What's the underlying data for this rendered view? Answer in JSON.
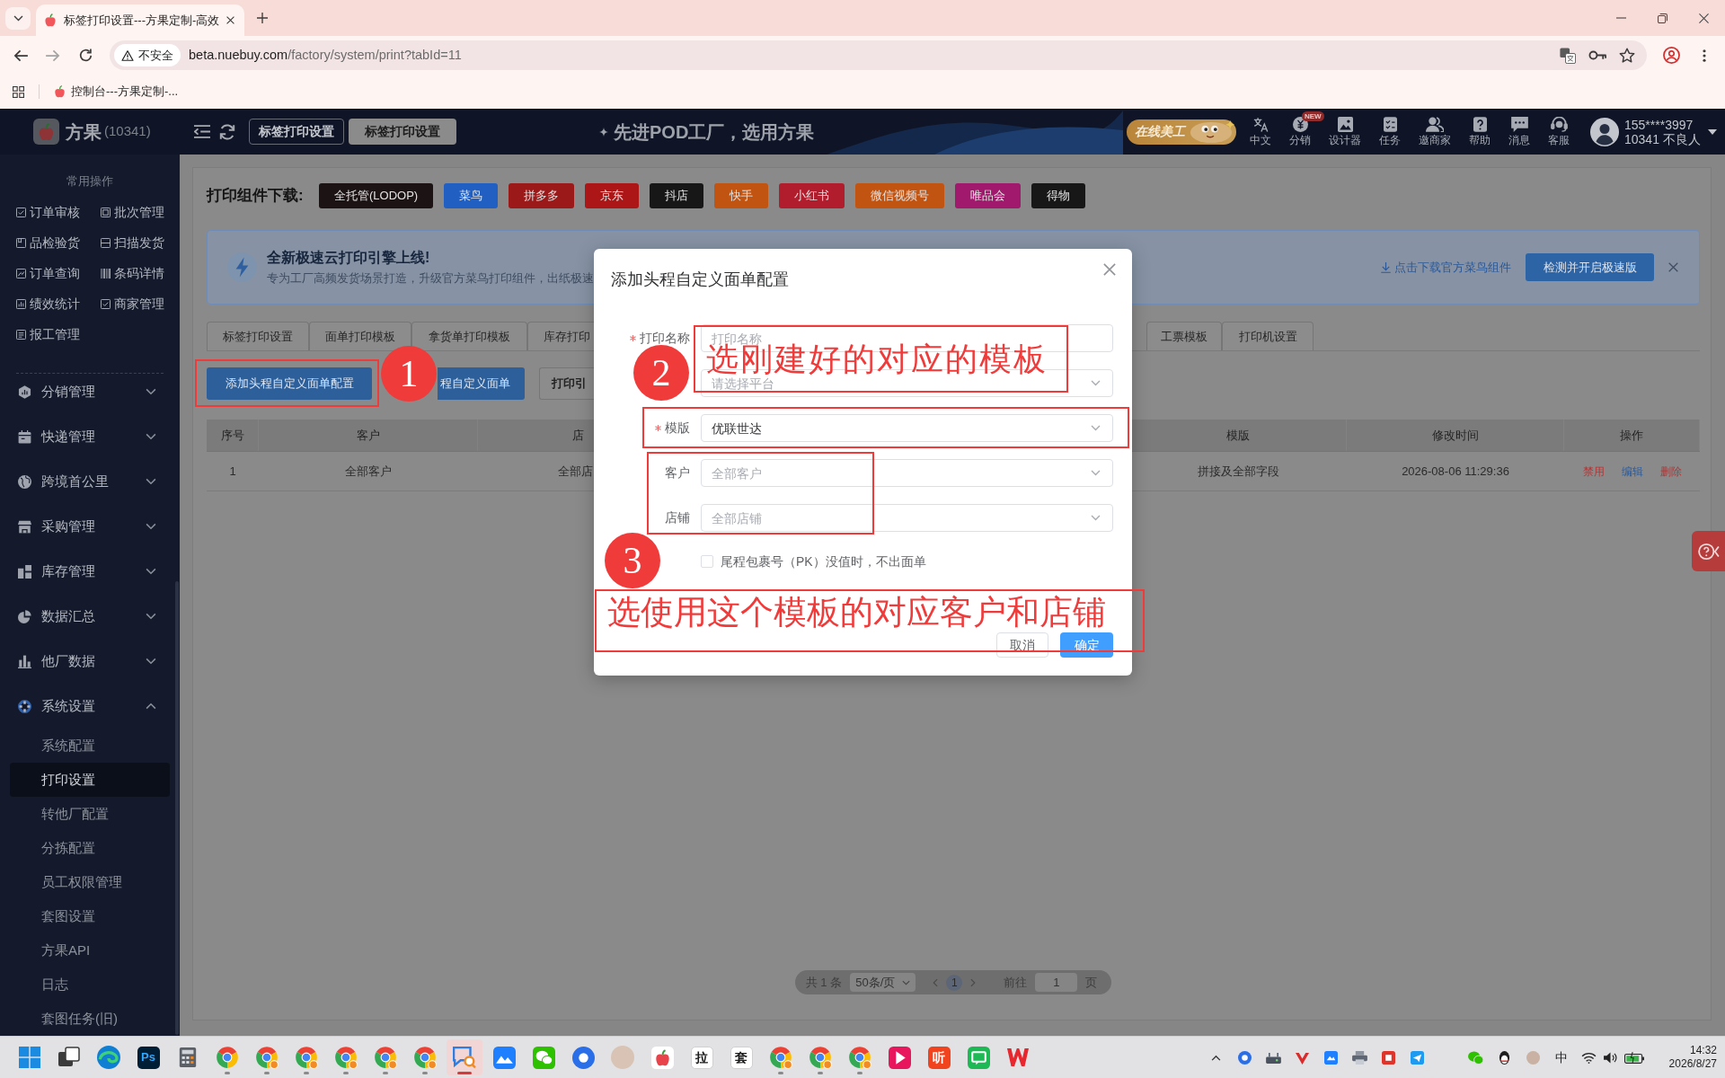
{
  "browser": {
    "tab_title": "标签打印设置---方果定制-高效",
    "security": "不安全",
    "url_host": "beta.nuebuy.com",
    "url_path": "/factory/system/print?tabId=11",
    "bookmarks": [
      {
        "label": "控制台---方果定制-..."
      }
    ]
  },
  "header": {
    "brand": "方果",
    "brand_id": "(10341)",
    "breadcrumbs": [
      {
        "label": "标签打印设置",
        "selected": false
      },
      {
        "label": "标签打印设置",
        "selected": true
      }
    ],
    "slogan": "先进POD工厂，选用方果",
    "promo": "在线美工",
    "tools": [
      {
        "kind": "translate",
        "label": "中文"
      },
      {
        "kind": "coin",
        "label": "分销",
        "badge": "NEW"
      },
      {
        "kind": "image",
        "label": "设计器"
      },
      {
        "kind": "task",
        "label": "任务"
      },
      {
        "kind": "people",
        "label": "邀商家"
      },
      {
        "kind": "help",
        "label": "帮助"
      },
      {
        "kind": "message",
        "label": "消息"
      },
      {
        "kind": "support",
        "label": "客服"
      }
    ],
    "user": {
      "phone": "155****3997",
      "account": "10341 不良人"
    }
  },
  "sidebar": {
    "quick_title": "常用操作",
    "quick": [
      {
        "kind": "check",
        "label": "订单审核"
      },
      {
        "kind": "batch",
        "label": "批次管理"
      },
      {
        "kind": "inspect",
        "label": "品检验货"
      },
      {
        "kind": "scan",
        "label": "扫描发货"
      },
      {
        "kind": "search",
        "label": "订单查询"
      },
      {
        "kind": "barcode",
        "label": "条码详情"
      },
      {
        "kind": "stats",
        "label": "绩效统计"
      },
      {
        "kind": "check",
        "label": "商家管理"
      },
      {
        "kind": "report",
        "label": "报工管理"
      }
    ],
    "menu": [
      {
        "kind": "distribution",
        "label": "分销管理",
        "expanded": false
      },
      {
        "kind": "express",
        "label": "快递管理",
        "expanded": false
      },
      {
        "kind": "globe",
        "label": "跨境首公里",
        "expanded": false
      },
      {
        "kind": "store",
        "label": "采购管理",
        "expanded": false
      },
      {
        "kind": "stock",
        "label": "库存管理",
        "expanded": false
      },
      {
        "kind": "pie",
        "label": "数据汇总",
        "expanded": false
      },
      {
        "kind": "bars",
        "label": "他厂数据",
        "expanded": false
      },
      {
        "kind": "settings",
        "label": "系统设置",
        "expanded": true,
        "children": [
          {
            "label": "系统配置",
            "selected": false
          },
          {
            "label": "打印设置",
            "selected": true
          },
          {
            "label": "转他厂配置",
            "selected": false
          },
          {
            "label": "分拣配置",
            "selected": false
          },
          {
            "label": "员工权限管理",
            "selected": false
          },
          {
            "label": "套图设置",
            "selected": false
          },
          {
            "label": "方果API",
            "selected": false
          },
          {
            "label": "日志",
            "selected": false
          },
          {
            "label": "套图任务(旧)",
            "selected": false
          }
        ]
      }
    ]
  },
  "main": {
    "download": {
      "label": "打印组件下载:",
      "items": [
        {
          "label": "全托管(LODOP)",
          "color": "#1c1315"
        },
        {
          "label": "菜鸟",
          "color": "#2160c2"
        },
        {
          "label": "拼多多",
          "color": "#9c1919"
        },
        {
          "label": "京东",
          "color": "#ad1616"
        },
        {
          "label": "抖店",
          "color": "#171717"
        },
        {
          "label": "快手",
          "color": "#c25412"
        },
        {
          "label": "小红书",
          "color": "#b21d2d"
        },
        {
          "label": "微信视频号",
          "color": "#c25412"
        },
        {
          "label": "唯品会",
          "color": "#a0196c"
        },
        {
          "label": "得物",
          "color": "#171717"
        }
      ]
    },
    "notice": {
      "title": "全新极速云打印引擎上线!",
      "text": "专为工厂高频发货场景打造，升级官方菜鸟打印组件，出纸极速",
      "link": "点击下载官方菜鸟组件",
      "button": "检测并开启极速版"
    },
    "tabs": [
      {
        "label": "标签打印设置"
      },
      {
        "label": "面单打印模板"
      },
      {
        "label": "拿货单打印模板"
      },
      {
        "label": "库存打印"
      },
      {
        "label": "工票模板"
      },
      {
        "label": "打印机设置"
      }
    ],
    "actions": [
      {
        "kind": "button",
        "label": "添加头程自定义面单配置"
      },
      {
        "kind": "button",
        "label": "程自定义面单"
      },
      {
        "kind": "select",
        "label": "打印引"
      }
    ],
    "table": {
      "columns": [
        "序号",
        "客户",
        "店",
        "模版",
        "修改时间",
        "操作"
      ],
      "rows": [
        {
          "cells": [
            "1",
            "全部客户",
            "全部店",
            "拼接及全部字段",
            "2026-08-06 11:29:36"
          ],
          "actions": [
            {
              "label": "禁用",
              "kind": "danger"
            },
            {
              "label": "编辑",
              "kind": "primary"
            },
            {
              "label": "删除",
              "kind": "danger"
            }
          ]
        }
      ]
    },
    "pagination": {
      "total": "共 1 条",
      "page_size": "50条/页",
      "pages": [
        {
          "label": "1",
          "selected": true
        }
      ],
      "goto_label": "前往",
      "goto_value": "1",
      "goto_unit": "页"
    }
  },
  "dialog": {
    "title": "添加头程自定义面单配置",
    "fields": [
      {
        "kind": "input",
        "label": "打印名称",
        "required": true,
        "placeholder": "打印名称"
      },
      {
        "kind": "select",
        "required": false,
        "placeholder": "请选择平台"
      },
      {
        "kind": "select",
        "label": "模版",
        "required": true,
        "value": "优联世达"
      },
      {
        "kind": "select",
        "label": "客户",
        "required": false,
        "placeholder": "全部客户"
      },
      {
        "kind": "select",
        "label": "店铺",
        "required": false,
        "placeholder": "全部店铺"
      }
    ],
    "checkbox": {
      "label": "尾程包裹号（PK）没值时，不出面单",
      "checked": false
    },
    "buttons": [
      {
        "kind": "secondary",
        "label": "取消"
      },
      {
        "kind": "primary",
        "label": "确定"
      }
    ]
  },
  "annotations": [
    {
      "number": "1"
    },
    {
      "number": "2",
      "note": "选刚建好的对应的模板"
    },
    {
      "number": "3",
      "note": "选使用这个模板的对应客户和店铺"
    }
  ],
  "taskbar": {
    "apps": [
      {
        "kind": "windows",
        "running": false,
        "active": false
      },
      {
        "kind": "taskview",
        "running": false,
        "active": false
      },
      {
        "kind": "edge",
        "running": false,
        "active": false
      },
      {
        "kind": "photoshop",
        "label": "Ps",
        "running": false,
        "active": false
      },
      {
        "kind": "calculator",
        "running": false,
        "active": false
      },
      {
        "kind": "chrome",
        "running": true,
        "active": false
      },
      {
        "kind": "chrome_profile",
        "running": true,
        "active": false
      },
      {
        "kind": "chrome_profile",
        "running": true,
        "active": false
      },
      {
        "kind": "chrome_profile",
        "running": true,
        "active": false
      },
      {
        "kind": "chrome_profile",
        "running": true,
        "active": false
      },
      {
        "kind": "chrome_profile",
        "running": true,
        "active": false
      },
      {
        "kind": "chat_search",
        "running": true,
        "active": true
      },
      {
        "kind": "cloud_doc",
        "running": false,
        "active": false
      },
      {
        "kind": "wechat",
        "running": false,
        "active": false
      },
      {
        "kind": "browser_blue",
        "running": false,
        "active": false
      },
      {
        "kind": "avatar",
        "running": false,
        "active": false
      },
      {
        "kind": "apple_app",
        "running": false,
        "active": false
      },
      {
        "kind": "letter_tile",
        "label": "拉",
        "running": false,
        "active": false
      },
      {
        "kind": "letter_tile",
        "label": "套",
        "running": false,
        "active": false
      },
      {
        "kind": "chrome_profile",
        "running": true,
        "active": false
      },
      {
        "kind": "chrome_profile",
        "running": true,
        "active": false
      },
      {
        "kind": "chrome_profile",
        "running": true,
        "active": false
      },
      {
        "kind": "flag_app",
        "running": false,
        "active": false
      },
      {
        "kind": "red_letter_tile",
        "label": "听",
        "running": false,
        "active": false
      },
      {
        "kind": "message_app",
        "running": false,
        "active": false
      },
      {
        "kind": "wps",
        "running": false,
        "active": false
      }
    ],
    "ime": "中",
    "time": "14:32",
    "date": "2026/8/27"
  }
}
